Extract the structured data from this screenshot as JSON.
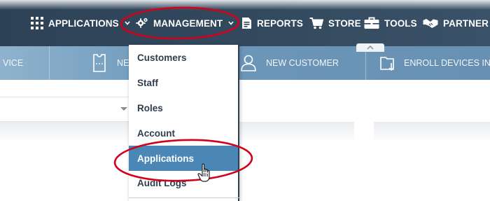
{
  "topnav": {
    "items": [
      {
        "label": "APPLICATIONS",
        "icon": "grid-icon",
        "has_caret": true
      },
      {
        "label": "MANAGEMENT",
        "icon": "gear-icon",
        "has_caret": true
      },
      {
        "label": "REPORTS",
        "icon": "report-icon",
        "has_caret": false
      },
      {
        "label": "STORE",
        "icon": "cart-icon",
        "has_caret": false
      },
      {
        "label": "TOOLS",
        "icon": "toolbox-icon",
        "has_caret": false
      },
      {
        "label": "PARTNER",
        "icon": "handshake-icon",
        "has_caret": false
      }
    ]
  },
  "ribbon": {
    "items": [
      {
        "label": "VICE",
        "icon": ""
      },
      {
        "label": "NE",
        "icon": "ticket-icon"
      },
      {
        "label": "NEW CUSTOMER",
        "icon": "user-icon"
      },
      {
        "label": "ENROLL DEVICES IN",
        "icon": "folder-download-icon"
      }
    ]
  },
  "management_menu": {
    "items": [
      "Customers",
      "Staff",
      "Roles",
      "Account",
      "Applications",
      "Audit Logs"
    ],
    "active": "Applications"
  },
  "colors": {
    "nav_bg": "#2d4257",
    "ribbon_bg": "#6790b3",
    "menu_active": "#4a86b6",
    "menu_text": "#2f3e4d",
    "highlight_ellipse": "#d0021b"
  }
}
